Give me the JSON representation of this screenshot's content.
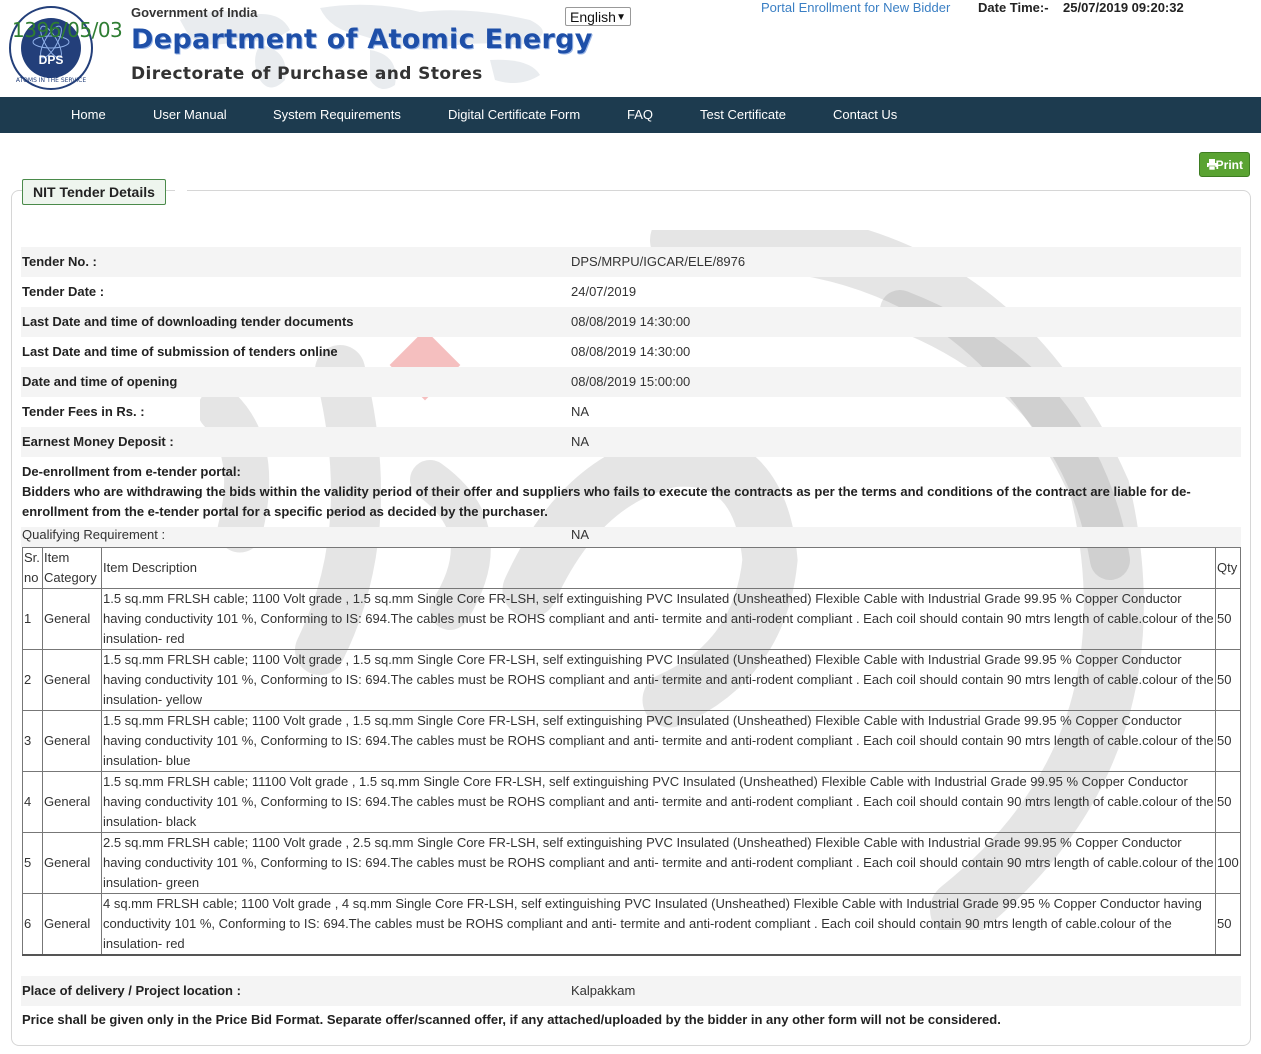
{
  "header": {
    "overlay_id": "1396/05/03",
    "gov_line": "Government of India",
    "dept_name": "Department of Atomic Energy",
    "directorate": "Directorate of Purchase and Stores",
    "logo_abbr": "DPS",
    "logo_hindi": "क्र भं नि",
    "language": "English",
    "enroll_link": "Portal Enrollment for New Bidder",
    "datetime_label": "Date Time:-",
    "datetime_value": "25/07/2019 09:20:32"
  },
  "nav": [
    "Home",
    "User Manual",
    "System Requirements",
    "Digital Certificate Form",
    "FAQ",
    "Test Certificate",
    "Contact Us"
  ],
  "print_label": "Print",
  "panel_title": "NIT Tender Details",
  "details": [
    {
      "label": "Tender No. :",
      "value": "DPS/MRPU/IGCAR/ELE/8976"
    },
    {
      "label": "Tender Date :",
      "value": "24/07/2019"
    },
    {
      "label": "Last Date and time of downloading tender documents",
      "value": "08/08/2019 14:30:00"
    },
    {
      "label": "Last Date and time of submission of tenders online",
      "value": "08/08/2019 14:30:00"
    },
    {
      "label": "Date and time of opening",
      "value": "08/08/2019 15:00:00"
    },
    {
      "label": "Tender Fees in Rs. :",
      "value": "NA"
    },
    {
      "label": "Earnest Money Deposit :",
      "value": "NA"
    }
  ],
  "deenrollment": {
    "title": "De-enrollment from e-tender portal:",
    "text": "Bidders who are withdrawing the bids within the validity period of their offer and suppliers who fails to execute the contracts as per the terms and conditions of the contract are liable for de-enrollment from the e-tender portal for a specific period as decided by the purchaser."
  },
  "qualifying": {
    "label": "Qualifying Requirement :",
    "value": "NA"
  },
  "items_table": {
    "headers": {
      "sr": "Sr. no",
      "category": "Item Category",
      "description": "Item Description",
      "qty": "Qty"
    },
    "rows": [
      {
        "sr": "1",
        "category": "General",
        "description": "1.5 sq.mm FRLSH cable; 1100 Volt grade , 1.5 sq.mm Single Core FR-LSH, self extinguishing PVC Insulated (Unsheathed) Flexible Cable with Industrial Grade 99.95 % Copper Conductor having conductivity 101 %, Conforming to IS: 694.The cables must be ROHS compliant and anti- termite and anti-rodent compliant . Each coil should contain 90 mtrs length of cable.colour of the insulation- red",
        "qty": "50"
      },
      {
        "sr": "2",
        "category": "General",
        "description": "1.5 sq.mm FRLSH cable; 1100 Volt grade , 1.5 sq.mm Single Core FR-LSH, self extinguishing PVC Insulated (Unsheathed) Flexible Cable with Industrial Grade 99.95 % Copper Conductor having conductivity 101 %, Conforming to IS: 694.The cables must be ROHS compliant and anti- termite and anti-rodent compliant . Each coil should contain 90 mtrs length of cable.colour of the insulation- yellow",
        "qty": "50"
      },
      {
        "sr": "3",
        "category": "General",
        "description": "1.5 sq.mm FRLSH cable; 1100 Volt grade , 1.5 sq.mm Single Core FR-LSH, self extinguishing PVC Insulated (Unsheathed) Flexible Cable with Industrial Grade 99.95 % Copper Conductor having conductivity 101 %, Conforming to IS: 694.The cables must be ROHS compliant and anti- termite and anti-rodent compliant . Each coil should contain 90 mtrs length of cable.colour of the insulation- blue",
        "qty": "50"
      },
      {
        "sr": "4",
        "category": "General",
        "description": "1.5 sq.mm FRLSH cable; 11100 Volt grade , 1.5 sq.mm Single Core FR-LSH, self extinguishing PVC Insulated (Unsheathed) Flexible Cable with Industrial Grade 99.95 % Copper Conductor having conductivity 101 %, Conforming to IS: 694.The cables must be ROHS compliant and anti- termite and anti-rodent compliant . Each coil should contain 90 mtrs length of cable.colour of the insulation- black",
        "qty": "50"
      },
      {
        "sr": "5",
        "category": "General",
        "description": "2.5 sq.mm FRLSH cable; 1100 Volt grade , 2.5 sq.mm Single Core FR-LSH, self extinguishing PVC Insulated (Unsheathed) Flexible Cable with Industrial Grade 99.95 % Copper Conductor having conductivity 101 %, Conforming to IS: 694.The cables must be ROHS compliant and anti- termite and anti-rodent compliant . Each coil should contain 90 mtrs length of cable.colour of the insulation- green",
        "qty": "100"
      },
      {
        "sr": "6",
        "category": "General",
        "description": "4 sq.mm FRLSH cable; 1100 Volt grade , 4 sq.mm Single Core FR-LSH, self extinguishing PVC Insulated (Unsheathed) Flexible Cable with Industrial Grade 99.95 % Copper Conductor having conductivity 101 %, Conforming to IS: 694.The cables must be ROHS compliant and anti- termite and anti-rodent compliant . Each coil should contain 90 mtrs length of cable.colour of the insulation- red",
        "qty": "50"
      }
    ]
  },
  "delivery": {
    "label": "Place of delivery / Project location :",
    "value": "Kalpakkam"
  },
  "price_note": "Price shall be given only in the Price Bid Format. Separate offer/scanned offer, if any attached/uploaded by the bidder in any other form will not be considered.",
  "colors": {
    "nav_bg": "#1d3b4f",
    "dept_blue": "#1e4fa8",
    "print_green": "#5aa332",
    "link_blue": "#3a7fc4"
  }
}
